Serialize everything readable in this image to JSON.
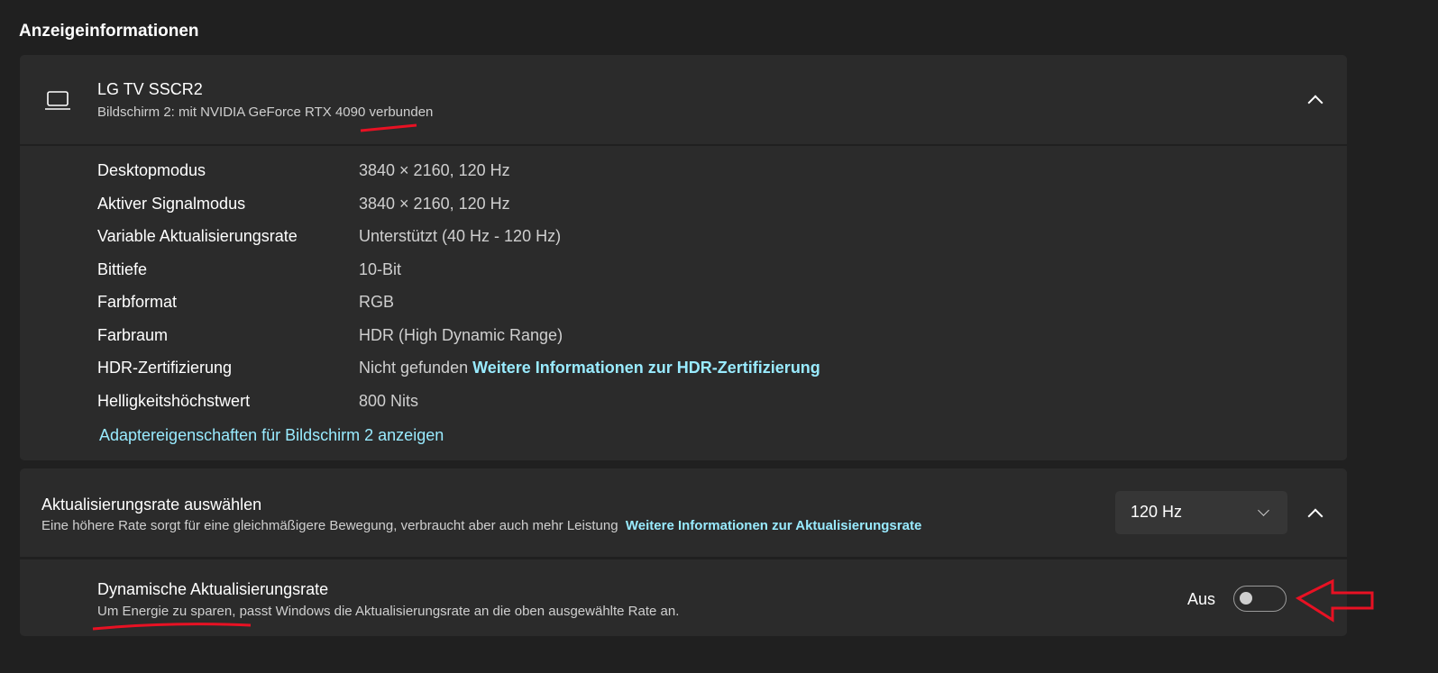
{
  "section_title": "Anzeigeinformationen",
  "display": {
    "name": "LG TV SSCR2",
    "subtitle": "Bildschirm 2: mit NVIDIA GeForce RTX 4090 verbunden",
    "rows": [
      {
        "label": "Desktopmodus",
        "value": "3840 × 2160, 120 Hz"
      },
      {
        "label": "Aktiver Signalmodus",
        "value": "3840 × 2160, 120 Hz"
      },
      {
        "label": "Variable Aktualisierungsrate",
        "value": "Unterstützt (40 Hz - 120 Hz)"
      },
      {
        "label": "Bittiefe",
        "value": "10-Bit"
      },
      {
        "label": "Farbformat",
        "value": "RGB"
      },
      {
        "label": "Farbraum",
        "value": "HDR (High Dynamic Range)"
      },
      {
        "label": "HDR-Zertifizierung",
        "value": "Nicht gefunden",
        "link": "Weitere Informationen zur HDR-Zertifizierung"
      },
      {
        "label": "Helligkeitshöchstwert",
        "value": "800 Nits"
      }
    ],
    "adapter_link": "Adaptereigenschaften für Bildschirm 2 anzeigen"
  },
  "refresh": {
    "title": "Aktualisierungsrate auswählen",
    "desc": "Eine höhere Rate sorgt für eine gleichmäßigere Bewegung, verbraucht aber auch mehr Leistung",
    "link": "Weitere Informationen zur Aktualisierungsrate",
    "selected": "120 Hz"
  },
  "dynamic": {
    "title": "Dynamische Aktualisierungsrate",
    "desc": "Um Energie zu sparen, passt Windows die Aktualisierungsrate an die oben ausgewählte Rate an.",
    "state_label": "Aus",
    "on": false
  },
  "colors": {
    "accent": "#99ebff",
    "annotation": "#e81123"
  }
}
